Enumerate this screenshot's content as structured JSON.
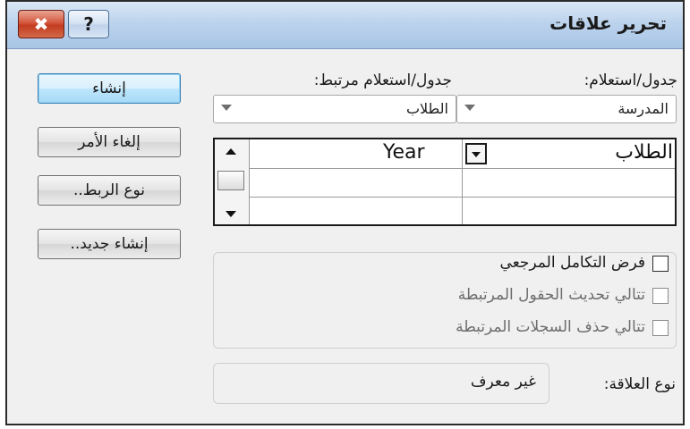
{
  "window": {
    "title": "تحرير علاقات",
    "close_glyph": "✖",
    "help_glyph": "?"
  },
  "labels": {
    "table_query": "جدول/استعلام:",
    "related_table_query": "جدول/استعلام مرتبط:"
  },
  "combos": {
    "table_query_value": "المدرسة",
    "related_table_query_value": "الطلاب"
  },
  "field_grid": {
    "rows": [
      {
        "table_field": "الطلاب",
        "related_field": "Year"
      },
      {
        "table_field": "",
        "related_field": ""
      },
      {
        "table_field": "",
        "related_field": ""
      }
    ]
  },
  "buttons": {
    "create": "إنشاء",
    "cancel": "إلغاء الأمر",
    "join_type": "نوع الربط..",
    "create_new": "إنشاء جديد.."
  },
  "options": {
    "enforce_integrity": {
      "label": "فرض التكامل المرجعي",
      "checked": false
    },
    "cascade_update": {
      "label": "تتالي تحديث الحقول المرتبطة",
      "checked": false
    },
    "cascade_delete": {
      "label": "تتالي حذف السجلات المرتبطة",
      "checked": false
    }
  },
  "relationship": {
    "label": "نوع العلاقة:",
    "value": "غير معرف"
  }
}
